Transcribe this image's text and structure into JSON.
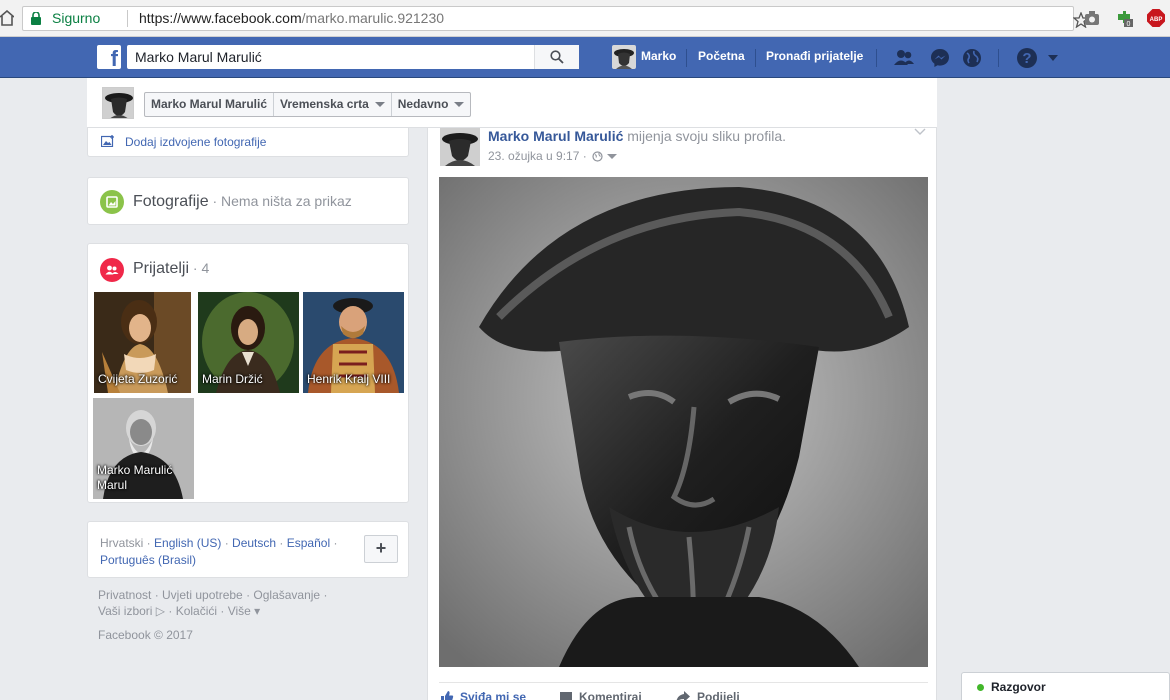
{
  "browser": {
    "secure_label": "Sigurno",
    "url_host": "https://www.facebook.com",
    "url_path": "/marko.marulic.921230",
    "ext_badge": "0",
    "abp_label": "ABP"
  },
  "topbar": {
    "logo": "f",
    "search_value": "Marko Marul Marulić",
    "user_name": "Marko",
    "home_link": "Početna",
    "find_friends_link": "Pronađi prijatelje"
  },
  "profile_header": {
    "name_tab": "Marko Marul Marulić",
    "timeline_tab": "Vremenska crta",
    "recent_tab": "Nedavno"
  },
  "left": {
    "featured_link": "Dodaj izdvojene fotografije",
    "photos_title": "Fotografije",
    "photos_sub": " · Nema ništa za prikaz",
    "friends_title": "Prijatelji",
    "friends_count": " · 4",
    "friends": [
      {
        "name": "Cvijeta Zuzorić"
      },
      {
        "name": "Marin Držić"
      },
      {
        "name": "Henrik Kralj VIII"
      },
      {
        "name": "Marko Marulić Marul"
      }
    ],
    "languages": {
      "current": "Hrvatski",
      "sep": " · ",
      "others": [
        "English (US)",
        "Deutsch",
        "Español",
        "Português (Brasil)"
      ],
      "add": "+"
    },
    "footer_links": "Privatnost · Uvjeti upotrebe · Oglašavanje · Vaši izbori ▷ · Kolačići · Više ▾",
    "copyright": "Facebook © 2017"
  },
  "post": {
    "author": "Marko Marul Marulić",
    "action": " mijenja svoju sliku profila.",
    "date": "23. ožujka u 9:17 ·",
    "like": "Sviđa mi se",
    "comment": "Komentiraj",
    "share": "Podijeli"
  },
  "chat": {
    "label": "Razgovor"
  },
  "colors": {
    "fb_blue": "#4267b2",
    "link_blue": "#365899",
    "page_bg": "#e9ebee",
    "online_green": "#42b72a"
  }
}
